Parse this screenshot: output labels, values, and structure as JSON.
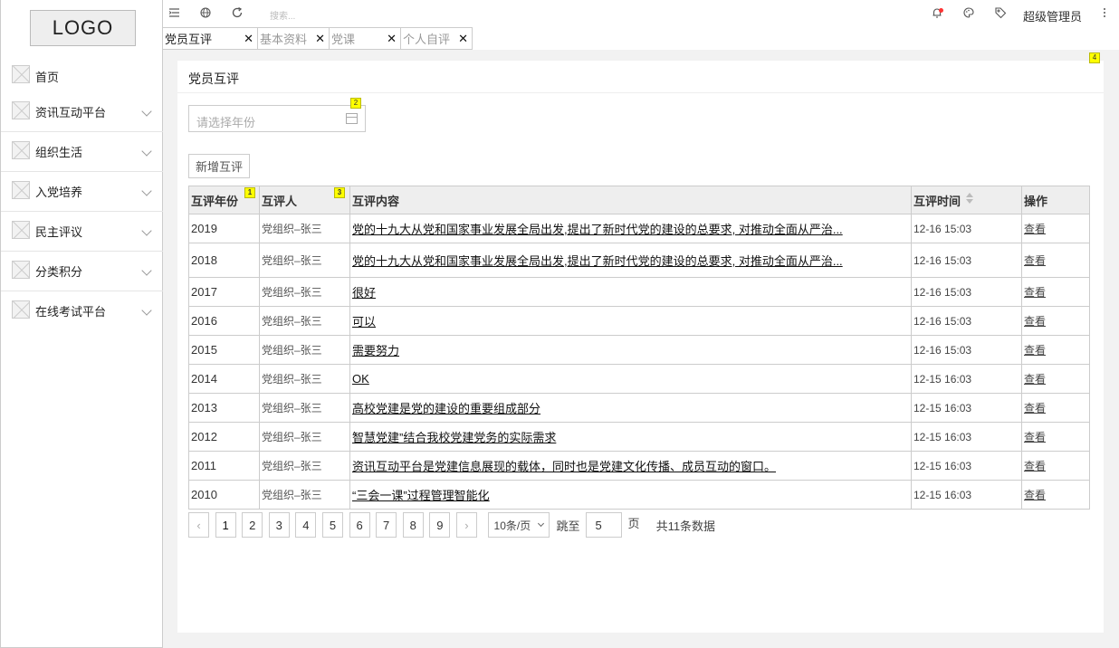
{
  "logo": "LOGO",
  "sidebar": {
    "items": [
      {
        "label": "首页"
      },
      {
        "label": "资讯互动平台"
      },
      {
        "label": "组织生活"
      },
      {
        "label": "入党培养"
      },
      {
        "label": "民主评议"
      },
      {
        "label": "分类积分"
      },
      {
        "label": "在线考试平台"
      }
    ]
  },
  "topbar": {
    "search_placeholder": "搜索...",
    "user": "超级管理员"
  },
  "tabs": [
    {
      "label": "党员互评"
    },
    {
      "label": "基本资料"
    },
    {
      "label": "党课"
    },
    {
      "label": "个人自评"
    }
  ],
  "tab_close": "✕",
  "panel": {
    "title": "党员互评",
    "year_placeholder": "请选择年份",
    "add_button": "新增互评"
  },
  "badges": [
    "1",
    "2",
    "3",
    "4"
  ],
  "table": {
    "headers": [
      "互评年份",
      "互评人",
      "互评内容",
      "互评时间",
      "操作"
    ],
    "rows": [
      {
        "year": "2019",
        "person": "党组织–张三",
        "content": "党的十九大从党和国家事业发展全局出发,提出了新时代党的建设的总要求, 对推动全面从严治...",
        "time": "12-16 15:03",
        "op": "查看"
      },
      {
        "year": "2018",
        "person": "党组织–张三",
        "content": "党的十九大从党和国家事业发展全局出发,提出了新时代党的建设的总要求, 对推动全面从严治...",
        "time": "12-16 15:03",
        "op": "查看"
      },
      {
        "year": "2017",
        "person": "党组织–张三",
        "content": "很好",
        "time": "12-16 15:03",
        "op": "查看"
      },
      {
        "year": "2016",
        "person": "党组织–张三",
        "content": "可以",
        "time": "12-16 15:03",
        "op": "查看"
      },
      {
        "year": "2015",
        "person": "党组织–张三",
        "content": "需要努力",
        "time": "12-16 15:03",
        "op": "查看"
      },
      {
        "year": "2014",
        "person": "党组织–张三",
        "content": "OK",
        "time": "12-15 16:03",
        "op": "查看"
      },
      {
        "year": "2013",
        "person": "党组织–张三",
        "content": "高校党建是党的建设的重要组成部分",
        "time": "12-15 16:03",
        "op": "查看"
      },
      {
        "year": "2012",
        "person": "党组织–张三",
        "content": "智慧党建”结合我校党建党务的实际需求",
        "time": "12-15 16:03",
        "op": "查看"
      },
      {
        "year": "2011",
        "person": "党组织–张三",
        "content": "资讯互动平台是党建信息展现的载体，同时也是党建文化传播、成员互动的窗口。",
        "time": "12-15 16:03",
        "op": "查看"
      },
      {
        "year": "2010",
        "person": "党组织–张三",
        "content": "“三会一课”过程管理智能化",
        "time": "12-15 16:03",
        "op": "查看"
      }
    ]
  },
  "pagination": {
    "prev": "‹",
    "next": "›",
    "pages": [
      "1",
      "2",
      "3",
      "4",
      "5",
      "6",
      "7",
      "8",
      "9"
    ],
    "page_size": "10条/页",
    "jump_label": "跳至",
    "jump_value": "5",
    "page_unit": "页",
    "total": "共11条数据"
  }
}
